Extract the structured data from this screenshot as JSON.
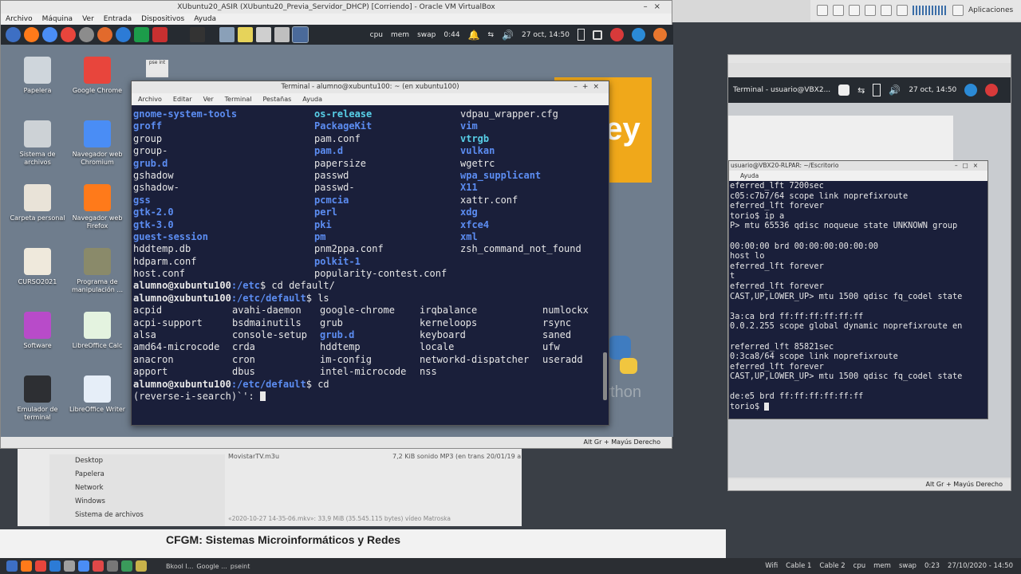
{
  "host": {
    "right_tray_label": "Aplicaciones",
    "caption": "CFGM: Sistemas Microinformáticos y Redes",
    "bottom_labels": [
      "Bkool I...",
      "Google ...",
      "pseint"
    ],
    "status_items": [
      "Wifi",
      "Cable 1",
      "Cable 2",
      "cpu",
      "mem",
      "swap",
      "0:23",
      "27/10/2020 - 14:50"
    ]
  },
  "vbox": {
    "title": "XUbuntu20_ASIR (XUbuntu20_Previa_Servidor_DHCP) [Corriendo] - Oracle VM VirtualBox",
    "menu": [
      "Archivo",
      "Máquina",
      "Ver",
      "Entrada",
      "Dispositivos",
      "Ayuda"
    ],
    "status_right": "Alt Gr + Mayús Derecho"
  },
  "guest_panel": {
    "cpu": "cpu",
    "mem": "mem",
    "swap": "swap",
    "time_small": "0:44",
    "datetime": "27 oct, 14:50"
  },
  "desktop_icons": [
    {
      "label": "Papelera",
      "color": "#cfd6dc"
    },
    {
      "label": "Google Chrome",
      "color": "#e8453c"
    },
    {
      "label": "Sistema de archivos",
      "color": "#cdd2d6"
    },
    {
      "label": "Navegador web Chromium",
      "color": "#4a8df5"
    },
    {
      "label": "Carpeta personal",
      "color": "#e9e3d8"
    },
    {
      "label": "Navegador web Firefox",
      "color": "#ff7a1a"
    },
    {
      "label": "CURSO2021",
      "color": "#efe9dc"
    },
    {
      "label": "Programa de manipulación ...",
      "color": "#8a8a6a"
    },
    {
      "label": "Software",
      "color": "#b84bc9"
    },
    {
      "label": "LibreOffice Calc",
      "color": "#e4f3e0"
    },
    {
      "label": "Emulador de terminal",
      "color": "#2d2f33"
    },
    {
      "label": "LibreOffice Writer",
      "color": "#e6eef8"
    }
  ],
  "terminal": {
    "title": "Terminal - alumno@xubuntu100: ~ (en xubuntu100)",
    "menu": [
      "Archivo",
      "Editar",
      "Ver",
      "Terminal",
      "Pestañas",
      "Ayuda"
    ],
    "listing": [
      [
        {
          "t": "gnome-system-tools",
          "s": "blue"
        },
        {
          "t": "os-release",
          "s": "cyan"
        },
        {
          "t": "vdpau_wrapper.cfg",
          "s": "plain"
        }
      ],
      [
        {
          "t": "groff",
          "s": "blue"
        },
        {
          "t": "PackageKit",
          "s": "blue"
        },
        {
          "t": "vim",
          "s": "blue"
        }
      ],
      [
        {
          "t": "group",
          "s": "plain"
        },
        {
          "t": "pam.conf",
          "s": "plain"
        },
        {
          "t": "vtrgb",
          "s": "cyan"
        }
      ],
      [
        {
          "t": "group-",
          "s": "plain"
        },
        {
          "t": "pam.d",
          "s": "blue"
        },
        {
          "t": "vulkan",
          "s": "blue"
        }
      ],
      [
        {
          "t": "grub.d",
          "s": "blue"
        },
        {
          "t": "papersize",
          "s": "plain"
        },
        {
          "t": "wgetrc",
          "s": "plain"
        }
      ],
      [
        {
          "t": "gshadow",
          "s": "plain"
        },
        {
          "t": "passwd",
          "s": "plain"
        },
        {
          "t": "wpa_supplicant",
          "s": "blue"
        }
      ],
      [
        {
          "t": "gshadow-",
          "s": "plain"
        },
        {
          "t": "passwd-",
          "s": "plain"
        },
        {
          "t": "X11",
          "s": "blue"
        }
      ],
      [
        {
          "t": "gss",
          "s": "blue"
        },
        {
          "t": "pcmcia",
          "s": "blue"
        },
        {
          "t": "xattr.conf",
          "s": "plain"
        }
      ],
      [
        {
          "t": "gtk-2.0",
          "s": "blue"
        },
        {
          "t": "perl",
          "s": "blue"
        },
        {
          "t": "xdg",
          "s": "blue"
        }
      ],
      [
        {
          "t": "gtk-3.0",
          "s": "blue"
        },
        {
          "t": "pki",
          "s": "blue"
        },
        {
          "t": "xfce4",
          "s": "blue"
        }
      ],
      [
        {
          "t": "guest-session",
          "s": "blue"
        },
        {
          "t": "pm",
          "s": "blue"
        },
        {
          "t": "xml",
          "s": "blue"
        }
      ],
      [
        {
          "t": "hddtemp.db",
          "s": "plain"
        },
        {
          "t": "pnm2ppa.conf",
          "s": "plain"
        },
        {
          "t": "zsh_command_not_found",
          "s": "plain"
        }
      ],
      [
        {
          "t": "hdparm.conf",
          "s": "plain"
        },
        {
          "t": "polkit-1",
          "s": "blue"
        },
        {
          "t": "",
          "s": "plain"
        }
      ],
      [
        {
          "t": "host.conf",
          "s": "plain"
        },
        {
          "t": "popularity-contest.conf",
          "s": "plain"
        },
        {
          "t": "",
          "s": "plain"
        }
      ]
    ],
    "prompt1": {
      "user": "alumno@xubuntu100",
      "path": ":/etc",
      "cmd": "$ cd default/"
    },
    "prompt2": {
      "user": "alumno@xubuntu100",
      "path": ":/etc/default",
      "cmd": "$ ls"
    },
    "ls_rows": [
      [
        {
          "t": "acpid",
          "s": "plain"
        },
        {
          "t": "avahi-daemon",
          "s": "plain"
        },
        {
          "t": "google-chrome",
          "s": "plain"
        },
        {
          "t": "irqbalance",
          "s": "plain"
        },
        {
          "t": "numlockx",
          "s": "plain"
        }
      ],
      [
        {
          "t": "acpi-support",
          "s": "plain"
        },
        {
          "t": "bsdmainutils",
          "s": "plain"
        },
        {
          "t": "grub",
          "s": "plain"
        },
        {
          "t": "kerneloops",
          "s": "plain"
        },
        {
          "t": "rsync",
          "s": "plain"
        }
      ],
      [
        {
          "t": "alsa",
          "s": "plain"
        },
        {
          "t": "console-setup",
          "s": "plain"
        },
        {
          "t": "grub.d",
          "s": "blue"
        },
        {
          "t": "keyboard",
          "s": "plain"
        },
        {
          "t": "saned",
          "s": "plain"
        }
      ],
      [
        {
          "t": "amd64-microcode",
          "s": "plain"
        },
        {
          "t": "crda",
          "s": "plain"
        },
        {
          "t": "hddtemp",
          "s": "plain"
        },
        {
          "t": "locale",
          "s": "plain"
        },
        {
          "t": "ufw",
          "s": "plain"
        }
      ],
      [
        {
          "t": "anacron",
          "s": "plain"
        },
        {
          "t": "cron",
          "s": "plain"
        },
        {
          "t": "im-config",
          "s": "plain"
        },
        {
          "t": "networkd-dispatcher",
          "s": "plain"
        },
        {
          "t": "useradd",
          "s": "plain"
        }
      ],
      [
        {
          "t": "apport",
          "s": "plain"
        },
        {
          "t": "dbus",
          "s": "plain"
        },
        {
          "t": "intel-microcode",
          "s": "plain"
        },
        {
          "t": "nss",
          "s": "plain"
        },
        {
          "t": "",
          "s": "plain"
        }
      ]
    ],
    "prompt3": {
      "user": "alumno@xubuntu100",
      "path": ":/etc/default",
      "cmd": "$ cd"
    },
    "search_line": "(reverse-i-search)`': "
  },
  "vm2": {
    "panel_title": "Terminal - usuario@VBX2...",
    "datetime": "27 oct, 14:50",
    "term_title": "usuario@VBX20-RLPAR: ~/Escritorio",
    "term_menu": "Ayuda",
    "lines": [
      "eferred_lft 7200sec",
      "c05:c7b7/64 scope link noprefixroute",
      "eferred_lft forever",
      "torio$ ip a",
      "P> mtu 65536 qdisc noqueue state UNKNOWN group",
      "",
      "00:00:00 brd 00:00:00:00:00:00",
      "host lo",
      "eferred_lft forever",
      "t",
      "eferred_lft forever",
      "CAST,UP,LOWER_UP> mtu 1500 qdisc fq_codel state",
      "",
      "3a:ca brd ff:ff:ff:ff:ff:ff",
      "0.0.2.255 scope global dynamic noprefixroute en",
      "",
      "referred_lft 85821sec",
      "0:3ca8/64 scope link noprefixroute",
      "eferred_lft forever",
      "CAST,UP,LOWER_UP> mtu 1500 qdisc fq_codel state",
      "",
      "de:e5 brd ff:ff:ff:ff:ff:ff",
      "torio$ "
    ],
    "status_right": "Alt Gr + Mayús Derecho"
  },
  "file_manager": {
    "sidebar": [
      "Desktop",
      "Papelera",
      "Network",
      "Windows",
      "Sistema de archivos"
    ],
    "row": "MovistarTV.m3u",
    "row_meta": "7,2 KiB  sonido MP3 (en trans 20/01/19 a",
    "status": "«2020-10-27 14-35-06.mkv»: 33,9 MiB (35.545.115 bytes) vídeo Matroska"
  }
}
